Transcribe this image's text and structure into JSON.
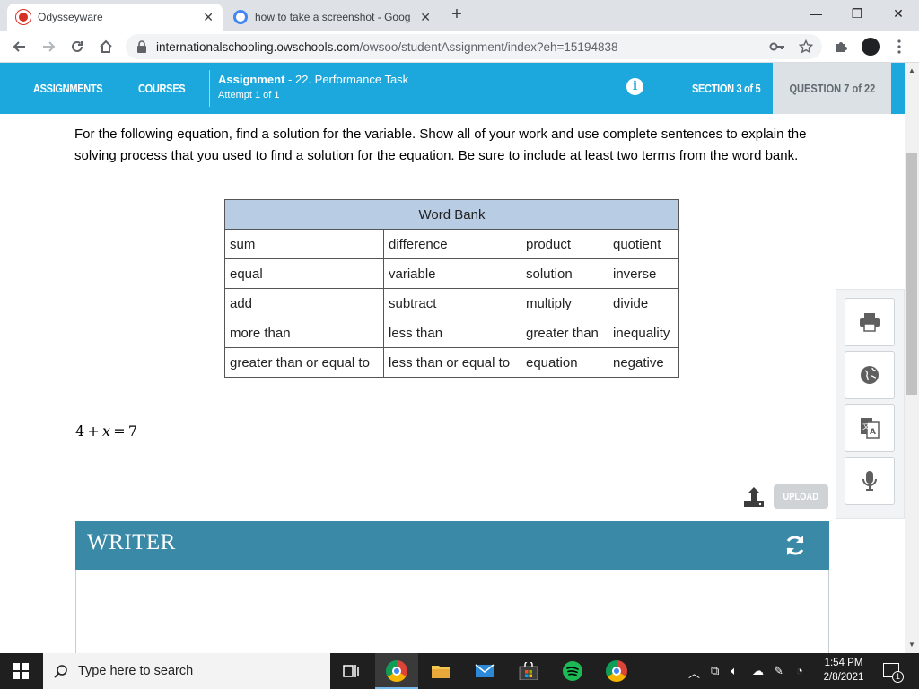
{
  "browser": {
    "tabs": [
      {
        "title": "Odysseyware",
        "active": true
      },
      {
        "title": "how to take a screenshot - Goog",
        "active": false
      }
    ],
    "url_host": "internationalschooling.owschools.com",
    "url_path": "/owsoo/studentAssignment/index?eh=15194838"
  },
  "header": {
    "nav": [
      "ASSIGNMENTS",
      "COURSES"
    ],
    "assignment_label": "Assignment",
    "assignment_name": " - 22. Performance Task",
    "attempt": "Attempt 1 of 1",
    "section": "SECTION 3 of 5",
    "question": "QUESTION 7 of 22",
    "accent_color": "#1ca8dd"
  },
  "content": {
    "prompt": "For the following equation, find a solution for the variable. Show all of your work and use complete sentences to explain the solving process that you used to find a solution for the equation. Be sure to include at least two terms from the word bank.",
    "word_bank": {
      "title": "Word Bank",
      "rows": [
        [
          "sum",
          "difference",
          "product",
          "quotient"
        ],
        [
          "equal",
          "variable",
          "solution",
          "inverse"
        ],
        [
          "add",
          "subtract",
          "multiply",
          "divide"
        ],
        [
          "more than",
          "less than",
          "greater than",
          "inequality"
        ],
        [
          "greater than or equal to",
          "less than or equal to",
          "equation",
          "negative"
        ]
      ]
    },
    "equation": {
      "left": "4",
      "op": "+",
      "var": "x",
      "eq": "=",
      "right": "7"
    }
  },
  "tools": [
    "print-icon",
    "globe-icon",
    "translate-icon",
    "microphone-icon"
  ],
  "upload": {
    "label": "UPLOAD"
  },
  "writer": {
    "title": "WRITER"
  },
  "taskbar": {
    "search_placeholder": "Type here to search",
    "time": "1:54 PM",
    "date": "2/8/2021",
    "notifications": "1"
  }
}
